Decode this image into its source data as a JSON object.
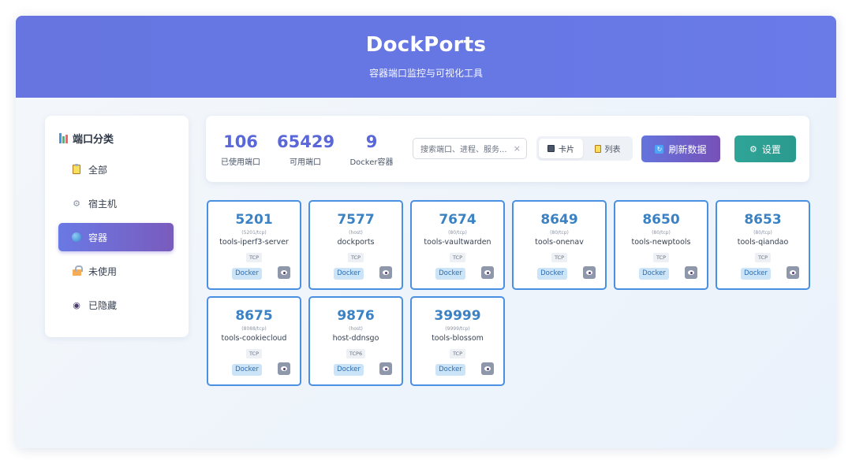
{
  "app": {
    "title": "DockPorts",
    "subtitle": "容器端口监控与可视化工具"
  },
  "sidebar": {
    "title": "端口分类",
    "title_icon": "bar-chart-icon",
    "items": [
      {
        "label": "全部",
        "icon": "clipboard-icon",
        "active": false
      },
      {
        "label": "宿主机",
        "icon": "gear-icon",
        "active": false
      },
      {
        "label": "容器",
        "icon": "globe-icon",
        "active": true
      },
      {
        "label": "未使用",
        "icon": "unlock-icon",
        "active": false
      },
      {
        "label": "已隐藏",
        "icon": "eye-icon",
        "active": false
      }
    ]
  },
  "stats": [
    {
      "value": "106",
      "label": "已使用端口"
    },
    {
      "value": "65429",
      "label": "可用端口"
    },
    {
      "value": "9",
      "label": "Docker容器"
    }
  ],
  "search": {
    "placeholder": "搜索端口、进程、服务...",
    "clear_icon": "×"
  },
  "view_toggle": {
    "card_label": "卡片",
    "list_label": "列表",
    "active": "card"
  },
  "buttons": {
    "refresh_label": "刷新数据",
    "settings_label": "设置",
    "settings_icon": "⚙"
  },
  "ports": [
    {
      "port": "5201",
      "mapping": "(5201/tcp)",
      "name": "tools-iperf3-server",
      "protocol": "TCP",
      "source": "Docker"
    },
    {
      "port": "7577",
      "mapping": "(host)",
      "name": "dockports",
      "protocol": "TCP",
      "source": "Docker"
    },
    {
      "port": "7674",
      "mapping": "(80/tcp)",
      "name": "tools-vaultwarden",
      "protocol": "TCP",
      "source": "Docker"
    },
    {
      "port": "8649",
      "mapping": "(80/tcp)",
      "name": "tools-onenav",
      "protocol": "TCP",
      "source": "Docker"
    },
    {
      "port": "8650",
      "mapping": "(80/tcp)",
      "name": "tools-newptools",
      "protocol": "TCP",
      "source": "Docker"
    },
    {
      "port": "8653",
      "mapping": "(80/tcp)",
      "name": "tools-qiandao",
      "protocol": "TCP",
      "source": "Docker"
    },
    {
      "port": "8675",
      "mapping": "(8088/tcp)",
      "name": "tools-cookiecloud",
      "protocol": "TCP",
      "source": "Docker"
    },
    {
      "port": "9876",
      "mapping": "(host)",
      "name": "host-ddnsgo",
      "protocol": "TCP6",
      "source": "Docker"
    },
    {
      "port": "39999",
      "mapping": "(9999/tcp)",
      "name": "tools-blossom",
      "protocol": "TCP",
      "source": "Docker"
    }
  ],
  "colors": {
    "header": "#6675e0",
    "accent": "#5a67d8",
    "card_border": "#4a90e2",
    "settings_button": "#2fa597"
  }
}
